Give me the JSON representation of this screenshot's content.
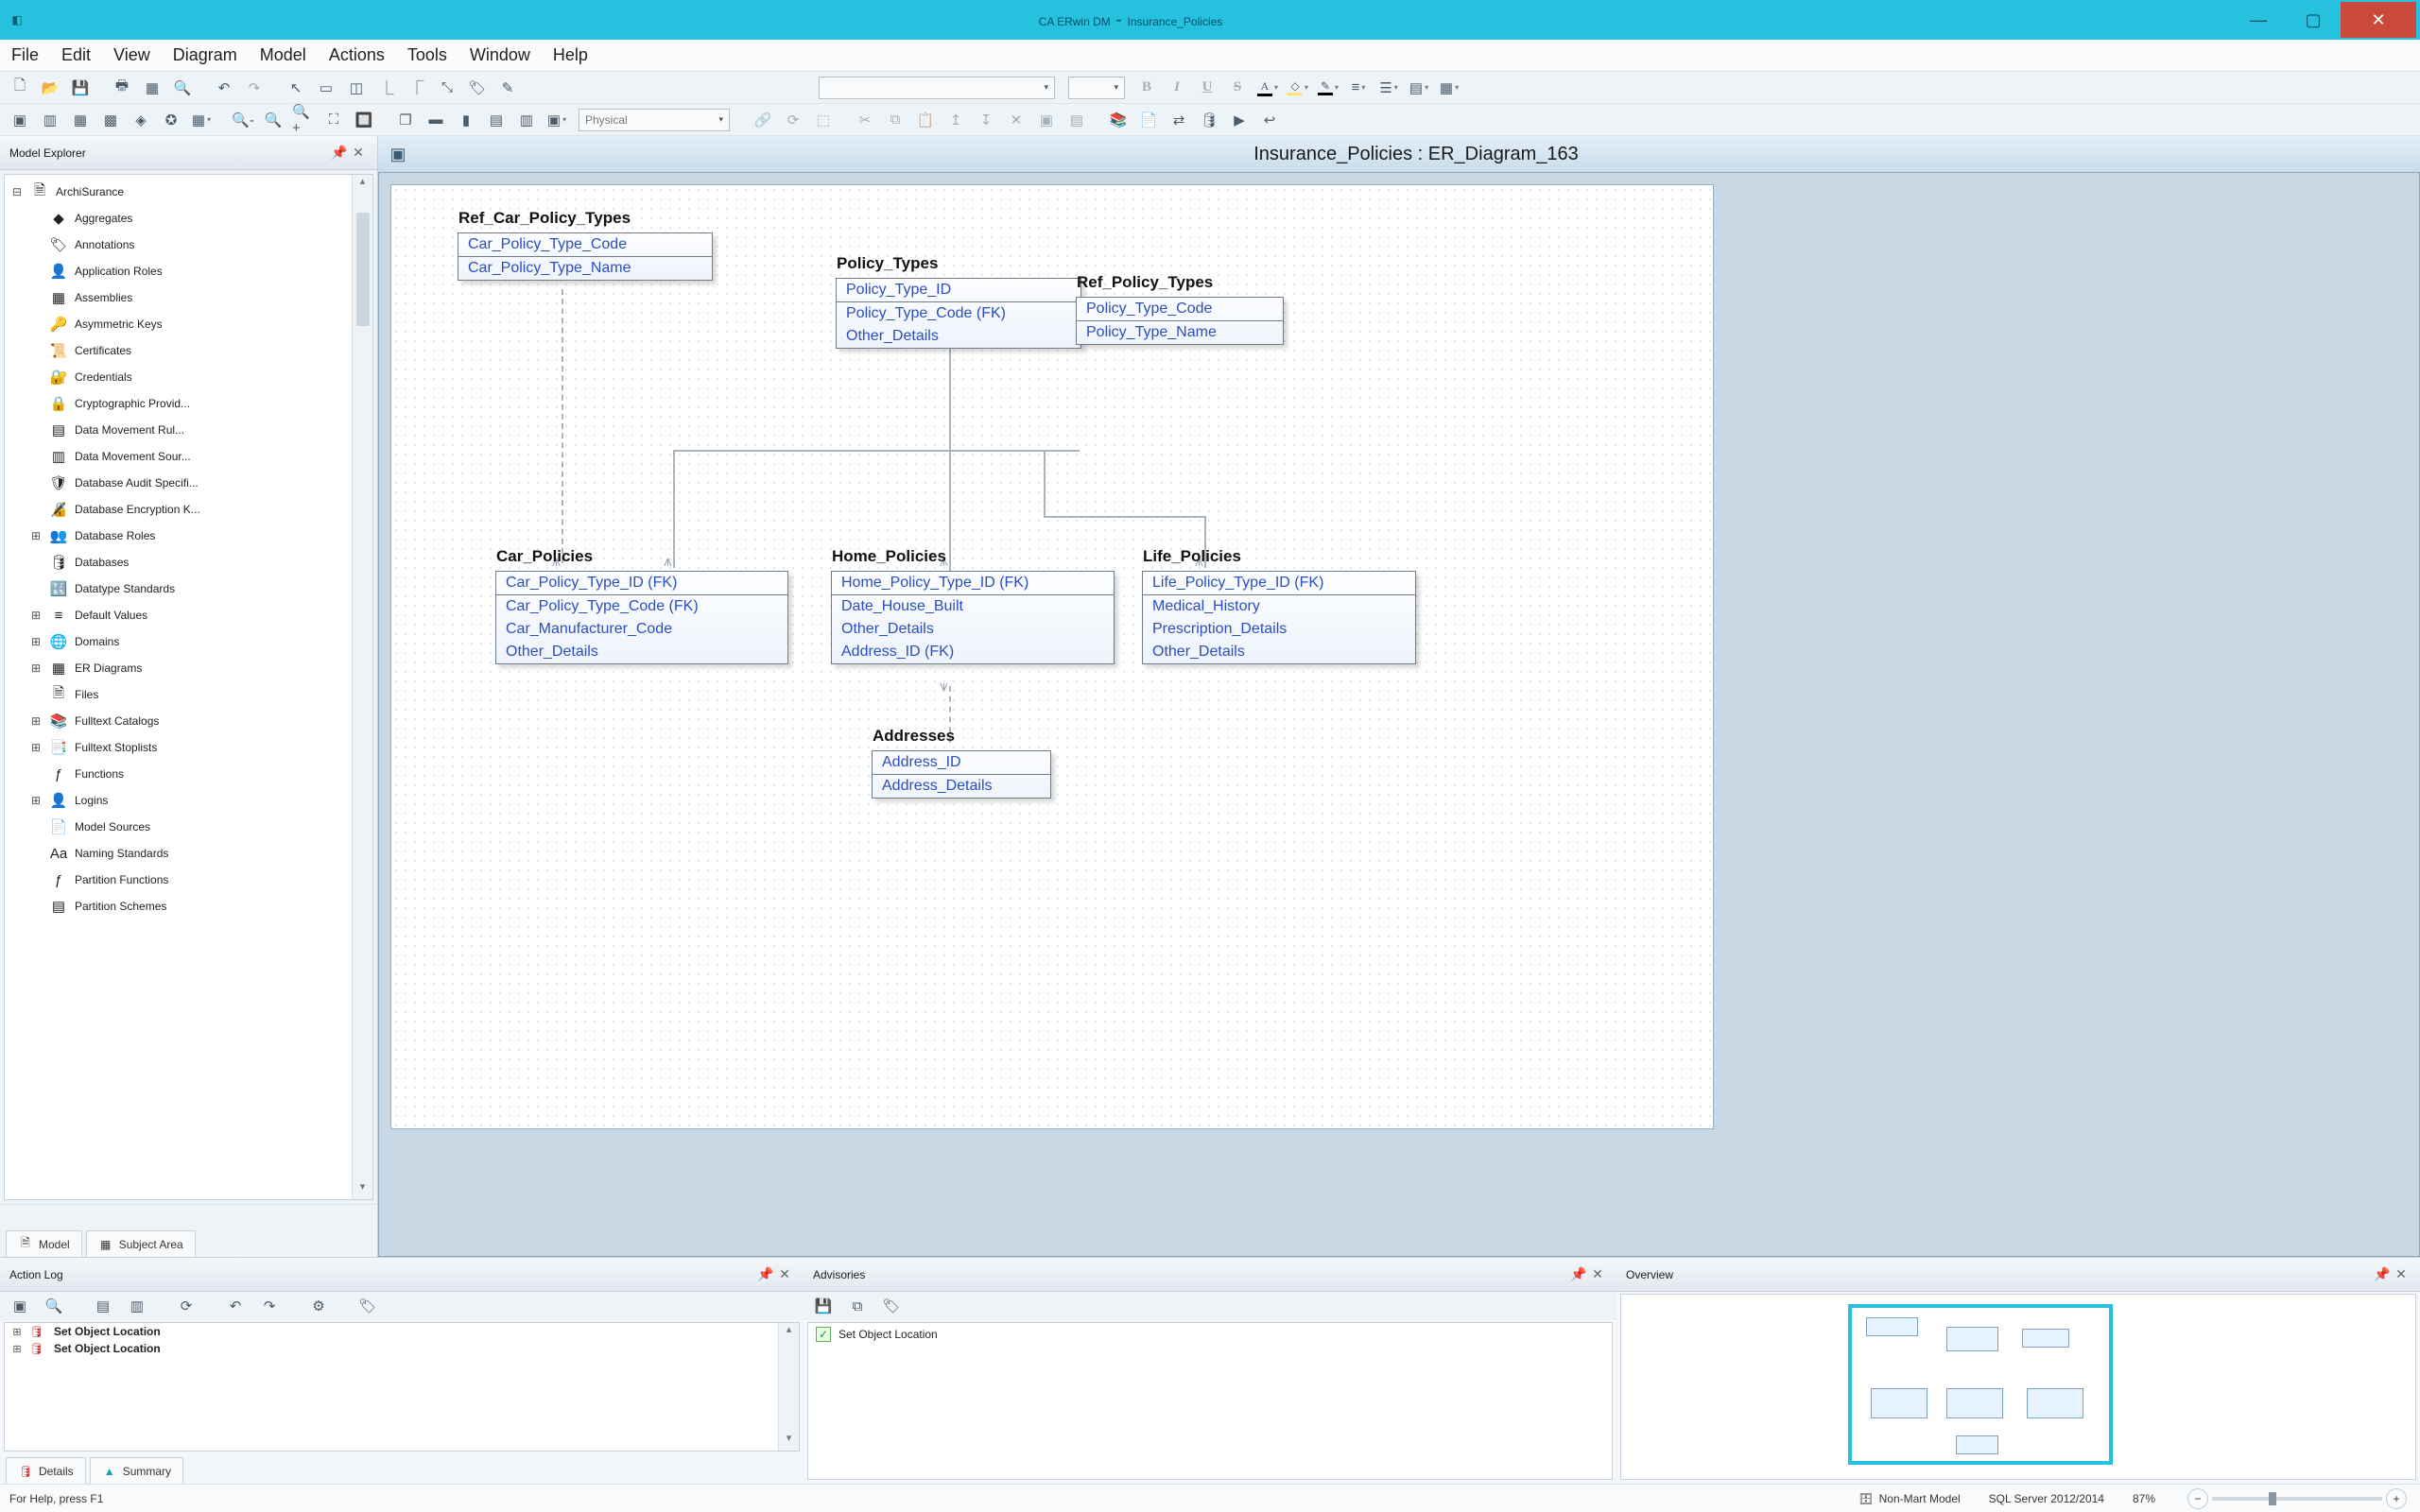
{
  "title_bar": {
    "app": "CA ERwin DM",
    "doc": "Insurance_Policies"
  },
  "menu": [
    "File",
    "Edit",
    "View",
    "Diagram",
    "Model",
    "Actions",
    "Tools",
    "Window",
    "Help"
  ],
  "view_mode": "Physical",
  "explorer": {
    "title": "Model Explorer",
    "root": "ArchiSurance",
    "items": [
      "Aggregates",
      "Annotations",
      "Application Roles",
      "Assemblies",
      "Asymmetric Keys",
      "Certificates",
      "Credentials",
      "Cryptographic Provid...",
      "Data Movement Rul...",
      "Data Movement Sour...",
      "Database Audit Specifi...",
      "Database Encryption K...",
      "Database Roles",
      "Databases",
      "Datatype Standards",
      "Default Values",
      "Domains",
      "ER Diagrams",
      "Files",
      "Fulltext Catalogs",
      "Fulltext Stoplists",
      "Functions",
      "Logins",
      "Model Sources",
      "Naming Standards",
      "Partition Functions",
      "Partition Schemes"
    ],
    "tabs": {
      "model": "Model",
      "subject_area": "Subject Area"
    }
  },
  "diagram": {
    "tab_title": "Insurance_Policies : ER_Diagram_163",
    "entities": {
      "ref_car_policy_types": {
        "name": "Ref_Car_Policy_Types",
        "pk": [
          "Car_Policy_Type_Code"
        ],
        "attrs": [
          "Car_Policy_Type_Name"
        ]
      },
      "policy_types": {
        "name": "Policy_Types",
        "pk": [
          "Policy_Type_ID"
        ],
        "attrs": [
          "Policy_Type_Code (FK)",
          "Other_Details"
        ]
      },
      "ref_policy_types": {
        "name": "Ref_Policy_Types",
        "pk": [
          "Policy_Type_Code"
        ],
        "attrs": [
          "Policy_Type_Name"
        ]
      },
      "car_policies": {
        "name": "Car_Policies",
        "pk": [
          "Car_Policy_Type_ID (FK)"
        ],
        "attrs": [
          "Car_Policy_Type_Code (FK)",
          "Car_Manufacturer_Code",
          "Other_Details"
        ]
      },
      "home_policies": {
        "name": "Home_Policies",
        "pk": [
          "Home_Policy_Type_ID (FK)"
        ],
        "attrs": [
          "Date_House_Built",
          "Other_Details",
          "Address_ID (FK)"
        ]
      },
      "life_policies": {
        "name": "Life_Policies",
        "pk": [
          "Life_Policy_Type_ID (FK)"
        ],
        "attrs": [
          "Medical_History",
          "Prescription_Details",
          "Other_Details"
        ]
      },
      "addresses": {
        "name": "Addresses",
        "pk": [
          "Address_ID"
        ],
        "attrs": [
          "Address_Details"
        ]
      }
    }
  },
  "action_log": {
    "title": "Action Log",
    "rows": [
      "Set Object Location",
      "Set Object Location"
    ],
    "tabs": {
      "details": "Details",
      "summary": "Summary"
    }
  },
  "advisories": {
    "title": "Advisories",
    "row": "Set Object Location"
  },
  "overview": {
    "title": "Overview"
  },
  "status": {
    "help": "For Help, press F1",
    "mart": "Non-Mart Model",
    "server": "SQL Server 2012/2014",
    "zoom": "87%"
  }
}
